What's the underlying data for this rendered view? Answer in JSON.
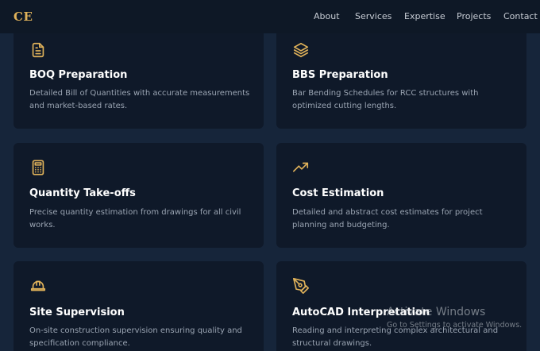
{
  "header": {
    "logo": "CE",
    "nav": [
      "About",
      "Services",
      "Expertise",
      "Projects",
      "Contact"
    ]
  },
  "services": [
    {
      "icon": "document-icon",
      "title": "BOQ Preparation",
      "description": "Detailed Bill of Quantities with accurate measurements and market-based rates."
    },
    {
      "icon": "layers-icon",
      "title": "BBS Preparation",
      "description": "Bar Bending Schedules for RCC structures with optimized cutting lengths."
    },
    {
      "icon": "calculator-icon",
      "title": "Quantity Take-offs",
      "description": "Precise quantity estimation from drawings for all civil works."
    },
    {
      "icon": "trending-up-icon",
      "title": "Cost Estimation",
      "description": "Detailed and abstract cost estimates for project planning and budgeting."
    },
    {
      "icon": "hard-hat-icon",
      "title": "Site Supervision",
      "description": "On-site construction supervision ensuring quality and specification compliance."
    },
    {
      "icon": "pen-tool-icon",
      "title": "AutoCAD Interpretation",
      "description": "Reading and interpreting complex architectural and structural drawings."
    }
  ],
  "watermark": {
    "line1": "Activate Windows",
    "line2": "Go to Settings to activate Windows."
  },
  "colors": {
    "background": "#16253a",
    "card": "#0f1929",
    "accent": "#e0b25a",
    "text_muted": "#9aa4b2"
  }
}
